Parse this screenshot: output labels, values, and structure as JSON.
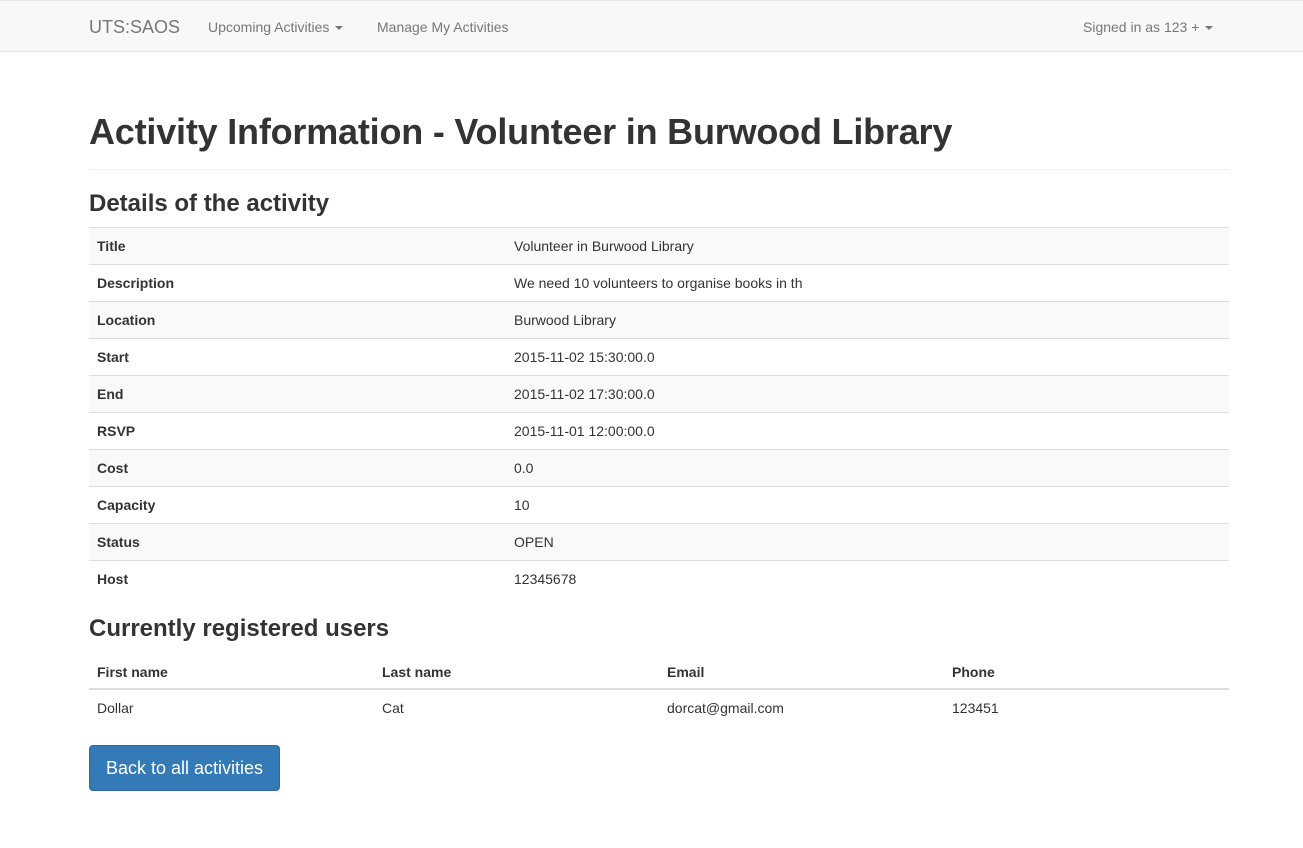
{
  "navbar": {
    "brand": "UTS:SAOS",
    "upcoming_label": "Upcoming Activities",
    "manage_label": "Manage My Activities",
    "signed_in_label": "Signed in as 123 +"
  },
  "page": {
    "title": "Activity Information - Volunteer in Burwood Library"
  },
  "details": {
    "heading": "Details of the activity",
    "rows": [
      {
        "label": "Title",
        "value": "Volunteer in Burwood Library"
      },
      {
        "label": "Description",
        "value": "We need 10 volunteers to organise books in th"
      },
      {
        "label": "Location",
        "value": "Burwood Library"
      },
      {
        "label": "Start",
        "value": "2015-11-02 15:30:00.0"
      },
      {
        "label": "End",
        "value": "2015-11-02 17:30:00.0"
      },
      {
        "label": "RSVP",
        "value": "2015-11-01 12:00:00.0"
      },
      {
        "label": "Cost",
        "value": "0.0"
      },
      {
        "label": "Capacity",
        "value": "10"
      },
      {
        "label": "Status",
        "value": "OPEN"
      },
      {
        "label": "Host",
        "value": "12345678"
      }
    ]
  },
  "users": {
    "heading": "Currently registered users",
    "columns": [
      "First name",
      "Last name",
      "Email",
      "Phone"
    ],
    "rows": [
      [
        "Dollar",
        "Cat",
        "dorcat@gmail.com",
        "123451"
      ]
    ]
  },
  "back_button_label": "Back to all activities",
  "colors": {
    "primary": "#337ab7",
    "navbar_bg": "#f8f8f8",
    "text": "#333333"
  }
}
